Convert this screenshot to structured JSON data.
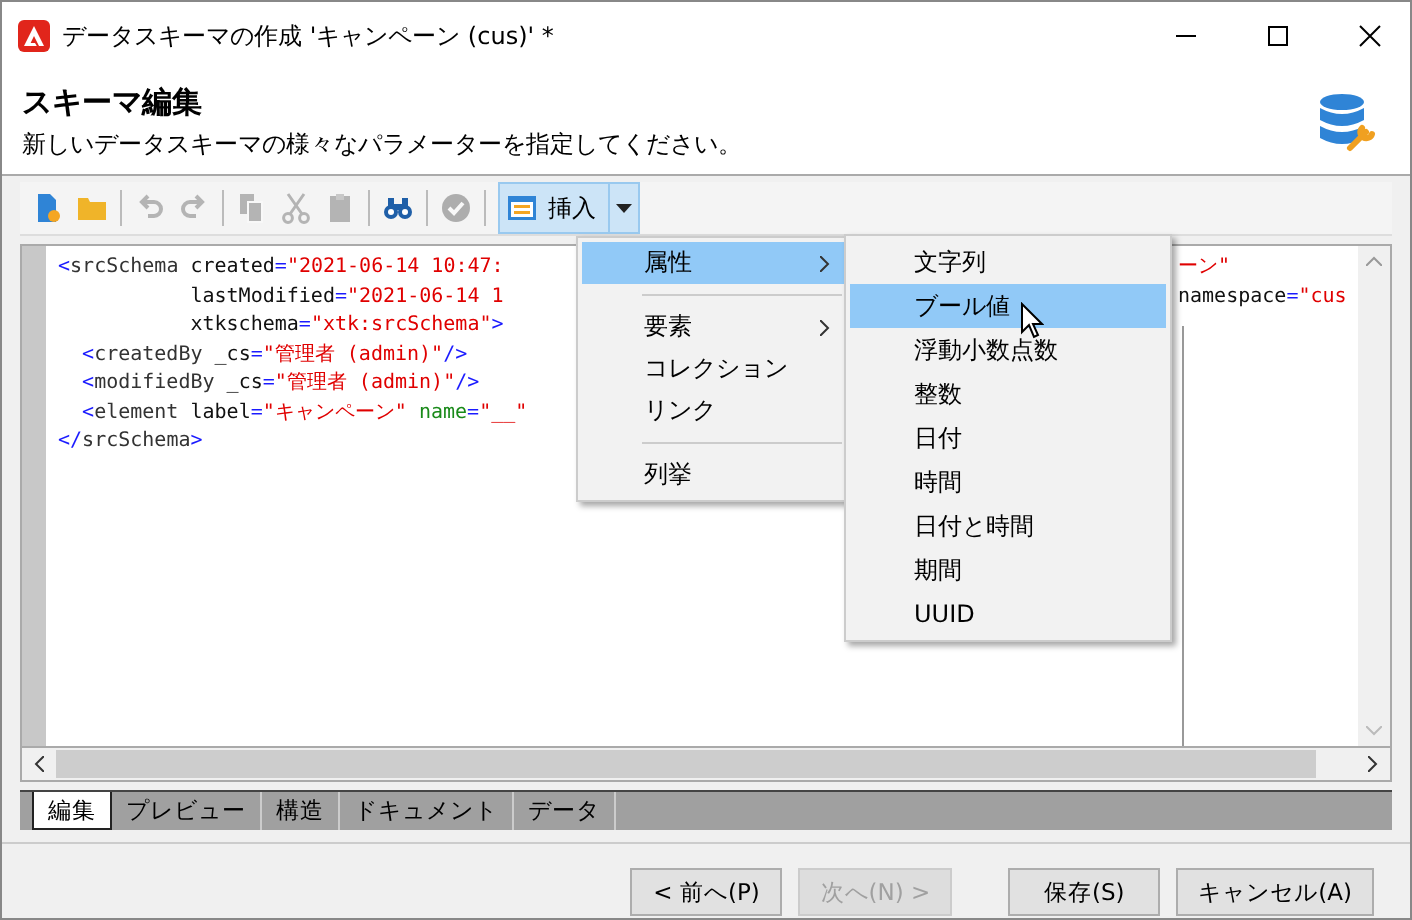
{
  "window": {
    "title": "データスキーマの作成 'キャンペーン (cus)' *"
  },
  "header": {
    "title": "スキーマ編集",
    "subtitle": "新しいデータスキーマの様々なパラメーターを指定してください。"
  },
  "toolbar": [
    {
      "kind": "new",
      "disabled": false
    },
    {
      "kind": "open",
      "disabled": false
    },
    {
      "kind": "sep"
    },
    {
      "kind": "undo",
      "disabled": true
    },
    {
      "kind": "redo",
      "disabled": true
    },
    {
      "kind": "sep"
    },
    {
      "kind": "copy",
      "disabled": true
    },
    {
      "kind": "cut",
      "disabled": true
    },
    {
      "kind": "paste",
      "disabled": true
    },
    {
      "kind": "sep"
    },
    {
      "kind": "find",
      "disabled": false
    },
    {
      "kind": "sep"
    },
    {
      "kind": "check",
      "disabled": true
    },
    {
      "kind": "sep"
    },
    {
      "kind": "insert",
      "label": "挿入",
      "expanded": true
    }
  ],
  "code": [
    {
      "kind": "root",
      "tokens": [
        {
          "kind": "punct",
          "text": "<"
        },
        {
          "kind": "tag",
          "text": "srcSchema "
        },
        {
          "kind": "attr",
          "text": "created"
        },
        {
          "kind": "punct",
          "text": "="
        },
        {
          "kind": "value",
          "text": "\"2021-06-14 10:47:"
        }
      ]
    },
    {
      "kind": "continued",
      "tokens": [
        {
          "kind": "attr",
          "text": "lastModified"
        },
        {
          "kind": "punct",
          "text": "="
        },
        {
          "kind": "value",
          "text": "\"2021-06-14 1"
        }
      ]
    },
    {
      "kind": "continued",
      "tokens": [
        {
          "kind": "attr",
          "text": "xtkschema"
        },
        {
          "kind": "punct",
          "text": "="
        },
        {
          "kind": "value",
          "text": "\"xtk:srcSchema\""
        },
        {
          "kind": "punct",
          "text": ">"
        }
      ]
    },
    {
      "kind": "child",
      "tokens": [
        {
          "kind": "punct",
          "text": "<"
        },
        {
          "kind": "tag",
          "text": "createdBy "
        },
        {
          "kind": "attr",
          "text": "_cs"
        },
        {
          "kind": "punct",
          "text": "="
        },
        {
          "kind": "value",
          "text": "\"管理者 (admin)\""
        },
        {
          "kind": "punct",
          "text": "/>"
        }
      ]
    },
    {
      "kind": "child",
      "tokens": [
        {
          "kind": "punct",
          "text": "<"
        },
        {
          "kind": "tag",
          "text": "modifiedBy "
        },
        {
          "kind": "attr",
          "text": "_cs"
        },
        {
          "kind": "punct",
          "text": "="
        },
        {
          "kind": "value",
          "text": "\"管理者 (admin)\""
        },
        {
          "kind": "punct",
          "text": "/>"
        }
      ]
    },
    {
      "kind": "child",
      "tokens": [
        {
          "kind": "punct",
          "text": "<"
        },
        {
          "kind": "tag",
          "text": "element "
        },
        {
          "kind": "attr",
          "text": "label"
        },
        {
          "kind": "punct",
          "text": "="
        },
        {
          "kind": "value",
          "text": "\"キャンペーン\" "
        },
        {
          "kind": "special",
          "text": "name"
        },
        {
          "kind": "punct",
          "text": "="
        },
        {
          "kind": "value",
          "text": "\"__\""
        }
      ]
    },
    {
      "kind": "root",
      "tokens": [
        {
          "kind": "punct",
          "text": "</"
        },
        {
          "kind": "tag",
          "text": "srcSchema"
        },
        {
          "kind": "punct",
          "text": ">"
        }
      ]
    }
  ],
  "code_tails": [
    [
      {
        "kind": "value",
        "text": "ーン\""
      }
    ],
    [
      {
        "kind": "attr",
        "text": "namespace"
      },
      {
        "kind": "punct",
        "text": "="
      },
      {
        "kind": "value",
        "text": "\"cus"
      }
    ]
  ],
  "menu": [
    {
      "kind": "item",
      "label": "属性",
      "submenu": true,
      "selected": true
    },
    {
      "kind": "sep"
    },
    {
      "kind": "item",
      "label": "要素",
      "submenu": true,
      "selected": false
    },
    {
      "kind": "item",
      "label": "コレクション",
      "submenu": false,
      "selected": false
    },
    {
      "kind": "item",
      "label": "リンク",
      "submenu": false,
      "selected": false
    },
    {
      "kind": "sep"
    },
    {
      "kind": "item",
      "label": "列挙",
      "submenu": false,
      "selected": false
    }
  ],
  "submenu": [
    {
      "label": "文字列",
      "selected": false
    },
    {
      "label": "ブール値",
      "selected": true
    },
    {
      "label": "浮動小数点数",
      "selected": false
    },
    {
      "label": "整数",
      "selected": false
    },
    {
      "label": "日付",
      "selected": false
    },
    {
      "label": "時間",
      "selected": false
    },
    {
      "label": "日付と時間",
      "selected": false
    },
    {
      "label": "期間",
      "selected": false
    },
    {
      "label": "UUID",
      "selected": false
    }
  ],
  "tabs": [
    {
      "label": "編集",
      "selected": true
    },
    {
      "label": "プレビュー",
      "selected": false
    },
    {
      "label": "構造",
      "selected": false
    },
    {
      "label": "ドキュメント",
      "selected": false
    },
    {
      "label": "データ",
      "selected": false
    }
  ],
  "buttons": [
    {
      "label": "< 前へ(P)",
      "disabled": false
    },
    {
      "label": "次へ(N) >",
      "disabled": true
    },
    {
      "label": "保存(S)",
      "disabled": false
    },
    {
      "label": "キャンセル(A)",
      "disabled": false
    }
  ]
}
